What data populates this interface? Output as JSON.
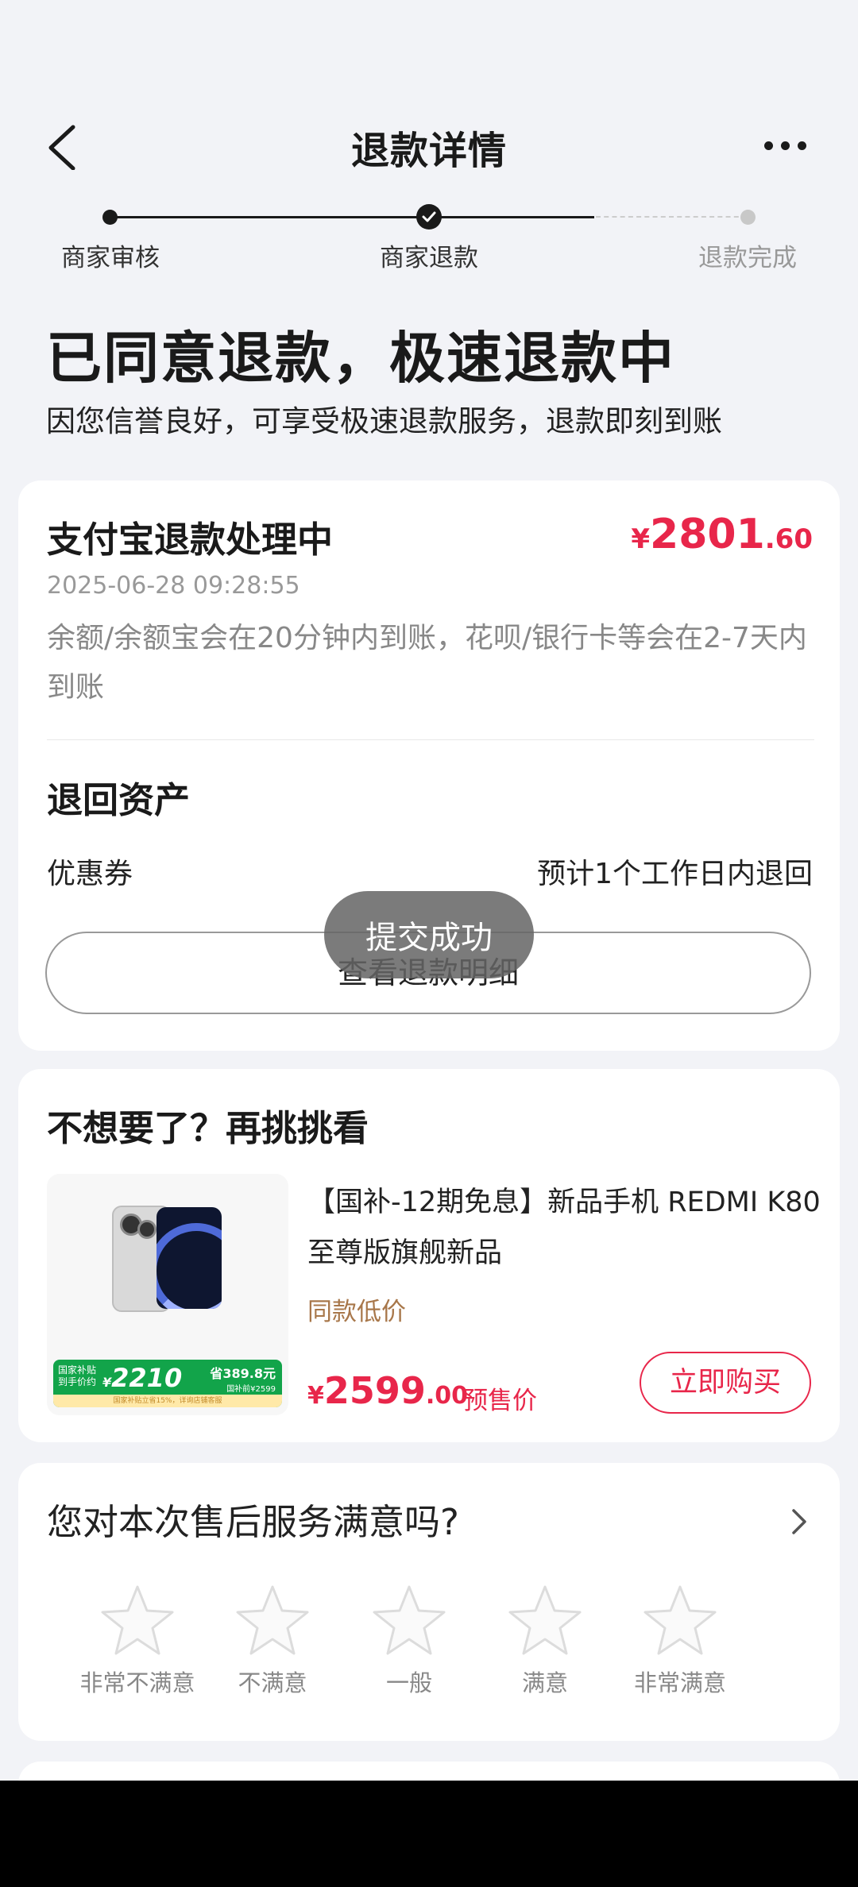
{
  "nav": {
    "title": "退款详情"
  },
  "progress": {
    "steps": [
      {
        "label": "商家审核"
      },
      {
        "label": "商家退款"
      },
      {
        "label": "退款完成"
      }
    ]
  },
  "status": {
    "headline": "已同意退款，极速退款中",
    "subline": "因您信誉良好，可享受极速退款服务，退款即刻到账"
  },
  "refund": {
    "title": "支付宝退款处理中",
    "currency": "¥",
    "amount_int": "2801",
    "amount_dec": ".60",
    "timestamp": "2025-06-28 09:28:55",
    "description": "余额/余额宝会在20分钟内到账，花呗/银行卡等会在2-7天内到账",
    "assets_title": "退回资产",
    "coupon_label": "优惠券",
    "coupon_value": "预计1个工作日内退回",
    "detail_button": "查看退款明细"
  },
  "toast": {
    "text": "提交成功"
  },
  "recommend": {
    "title": "不想要了？再挑挑看",
    "product": {
      "name": "【国补-12期免息】新品手机 REDMI K80 至尊版旗舰新品",
      "tag": "同款低价",
      "currency": "¥",
      "price_int": "2599",
      "price_dec": ".00",
      "price_note": "预售价",
      "buy_button": "立即购买",
      "promo": {
        "left_line1": "国家补贴",
        "left_line2": "到手价约",
        "currency": "¥",
        "price": "2210",
        "save": "省389.8元",
        "sub": "国补前¥2599",
        "strip": "国家补贴立省15%，详询店铺客服"
      }
    }
  },
  "satisfaction": {
    "title": "您对本次售后服务满意吗?",
    "ratings": [
      {
        "label": "非常不满意"
      },
      {
        "label": "不满意"
      },
      {
        "label": "一般"
      },
      {
        "label": "满意"
      },
      {
        "label": "非常满意"
      }
    ]
  },
  "colors": {
    "accent": "#e8264a",
    "background": "#f2f3f7",
    "tag": "#a8774a"
  }
}
